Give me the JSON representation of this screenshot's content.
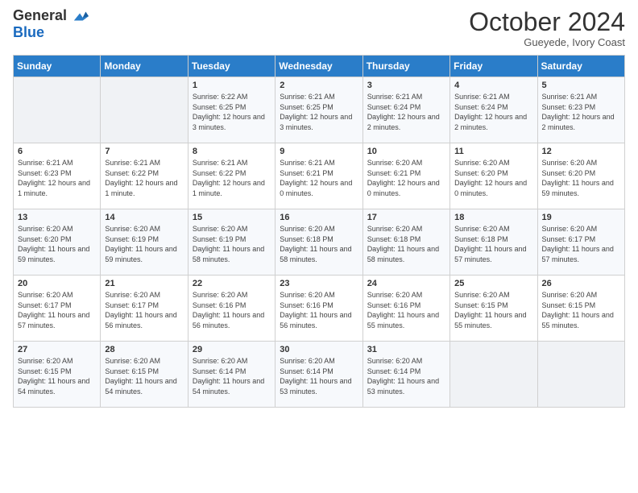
{
  "header": {
    "logo_general": "General",
    "logo_blue": "Blue",
    "month_title": "October 2024",
    "location": "Gueyede, Ivory Coast"
  },
  "days_of_week": [
    "Sunday",
    "Monday",
    "Tuesday",
    "Wednesday",
    "Thursday",
    "Friday",
    "Saturday"
  ],
  "weeks": [
    [
      {
        "day": "",
        "info": ""
      },
      {
        "day": "",
        "info": ""
      },
      {
        "day": "1",
        "info": "Sunrise: 6:22 AM\nSunset: 6:25 PM\nDaylight: 12 hours and 3 minutes."
      },
      {
        "day": "2",
        "info": "Sunrise: 6:21 AM\nSunset: 6:25 PM\nDaylight: 12 hours and 3 minutes."
      },
      {
        "day": "3",
        "info": "Sunrise: 6:21 AM\nSunset: 6:24 PM\nDaylight: 12 hours and 2 minutes."
      },
      {
        "day": "4",
        "info": "Sunrise: 6:21 AM\nSunset: 6:24 PM\nDaylight: 12 hours and 2 minutes."
      },
      {
        "day": "5",
        "info": "Sunrise: 6:21 AM\nSunset: 6:23 PM\nDaylight: 12 hours and 2 minutes."
      }
    ],
    [
      {
        "day": "6",
        "info": "Sunrise: 6:21 AM\nSunset: 6:23 PM\nDaylight: 12 hours and 1 minute."
      },
      {
        "day": "7",
        "info": "Sunrise: 6:21 AM\nSunset: 6:22 PM\nDaylight: 12 hours and 1 minute."
      },
      {
        "day": "8",
        "info": "Sunrise: 6:21 AM\nSunset: 6:22 PM\nDaylight: 12 hours and 1 minute."
      },
      {
        "day": "9",
        "info": "Sunrise: 6:21 AM\nSunset: 6:21 PM\nDaylight: 12 hours and 0 minutes."
      },
      {
        "day": "10",
        "info": "Sunrise: 6:20 AM\nSunset: 6:21 PM\nDaylight: 12 hours and 0 minutes."
      },
      {
        "day": "11",
        "info": "Sunrise: 6:20 AM\nSunset: 6:20 PM\nDaylight: 12 hours and 0 minutes."
      },
      {
        "day": "12",
        "info": "Sunrise: 6:20 AM\nSunset: 6:20 PM\nDaylight: 11 hours and 59 minutes."
      }
    ],
    [
      {
        "day": "13",
        "info": "Sunrise: 6:20 AM\nSunset: 6:20 PM\nDaylight: 11 hours and 59 minutes."
      },
      {
        "day": "14",
        "info": "Sunrise: 6:20 AM\nSunset: 6:19 PM\nDaylight: 11 hours and 59 minutes."
      },
      {
        "day": "15",
        "info": "Sunrise: 6:20 AM\nSunset: 6:19 PM\nDaylight: 11 hours and 58 minutes."
      },
      {
        "day": "16",
        "info": "Sunrise: 6:20 AM\nSunset: 6:18 PM\nDaylight: 11 hours and 58 minutes."
      },
      {
        "day": "17",
        "info": "Sunrise: 6:20 AM\nSunset: 6:18 PM\nDaylight: 11 hours and 58 minutes."
      },
      {
        "day": "18",
        "info": "Sunrise: 6:20 AM\nSunset: 6:18 PM\nDaylight: 11 hours and 57 minutes."
      },
      {
        "day": "19",
        "info": "Sunrise: 6:20 AM\nSunset: 6:17 PM\nDaylight: 11 hours and 57 minutes."
      }
    ],
    [
      {
        "day": "20",
        "info": "Sunrise: 6:20 AM\nSunset: 6:17 PM\nDaylight: 11 hours and 57 minutes."
      },
      {
        "day": "21",
        "info": "Sunrise: 6:20 AM\nSunset: 6:17 PM\nDaylight: 11 hours and 56 minutes."
      },
      {
        "day": "22",
        "info": "Sunrise: 6:20 AM\nSunset: 6:16 PM\nDaylight: 11 hours and 56 minutes."
      },
      {
        "day": "23",
        "info": "Sunrise: 6:20 AM\nSunset: 6:16 PM\nDaylight: 11 hours and 56 minutes."
      },
      {
        "day": "24",
        "info": "Sunrise: 6:20 AM\nSunset: 6:16 PM\nDaylight: 11 hours and 55 minutes."
      },
      {
        "day": "25",
        "info": "Sunrise: 6:20 AM\nSunset: 6:15 PM\nDaylight: 11 hours and 55 minutes."
      },
      {
        "day": "26",
        "info": "Sunrise: 6:20 AM\nSunset: 6:15 PM\nDaylight: 11 hours and 55 minutes."
      }
    ],
    [
      {
        "day": "27",
        "info": "Sunrise: 6:20 AM\nSunset: 6:15 PM\nDaylight: 11 hours and 54 minutes."
      },
      {
        "day": "28",
        "info": "Sunrise: 6:20 AM\nSunset: 6:15 PM\nDaylight: 11 hours and 54 minutes."
      },
      {
        "day": "29",
        "info": "Sunrise: 6:20 AM\nSunset: 6:14 PM\nDaylight: 11 hours and 54 minutes."
      },
      {
        "day": "30",
        "info": "Sunrise: 6:20 AM\nSunset: 6:14 PM\nDaylight: 11 hours and 53 minutes."
      },
      {
        "day": "31",
        "info": "Sunrise: 6:20 AM\nSunset: 6:14 PM\nDaylight: 11 hours and 53 minutes."
      },
      {
        "day": "",
        "info": ""
      },
      {
        "day": "",
        "info": ""
      }
    ]
  ]
}
